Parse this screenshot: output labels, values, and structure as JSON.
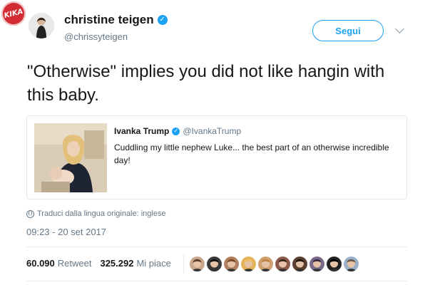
{
  "watermark": {
    "text": "KIKA"
  },
  "tweet": {
    "author": {
      "name": "christine teigen",
      "handle": "@chrissyteigen"
    },
    "follow_label": "Segui",
    "text": "\"Otherwise\" implies you did not like hangin with this baby.",
    "quote": {
      "author_name": "Ivanka Trump",
      "author_handle": "@IvankaTrump",
      "text": "Cuddling my little nephew Luke... the best part of an otherwise incredible day!"
    },
    "translate_label": "Traduci dalla lingua originale: inglese",
    "timestamp": "09:23 - 20 set 2017",
    "stats": {
      "retweets": "60.090",
      "retweets_label": "Retweet",
      "likes": "325.292",
      "likes_label": "Mi piace"
    },
    "liker_avatars": 10
  },
  "colors": {
    "accent": "#1da1f2",
    "secondary_text": "#657786",
    "watermark": "#d22b33"
  },
  "icons": [
    "verified-badge-icon",
    "chevron-down-icon",
    "globe-icon"
  ]
}
